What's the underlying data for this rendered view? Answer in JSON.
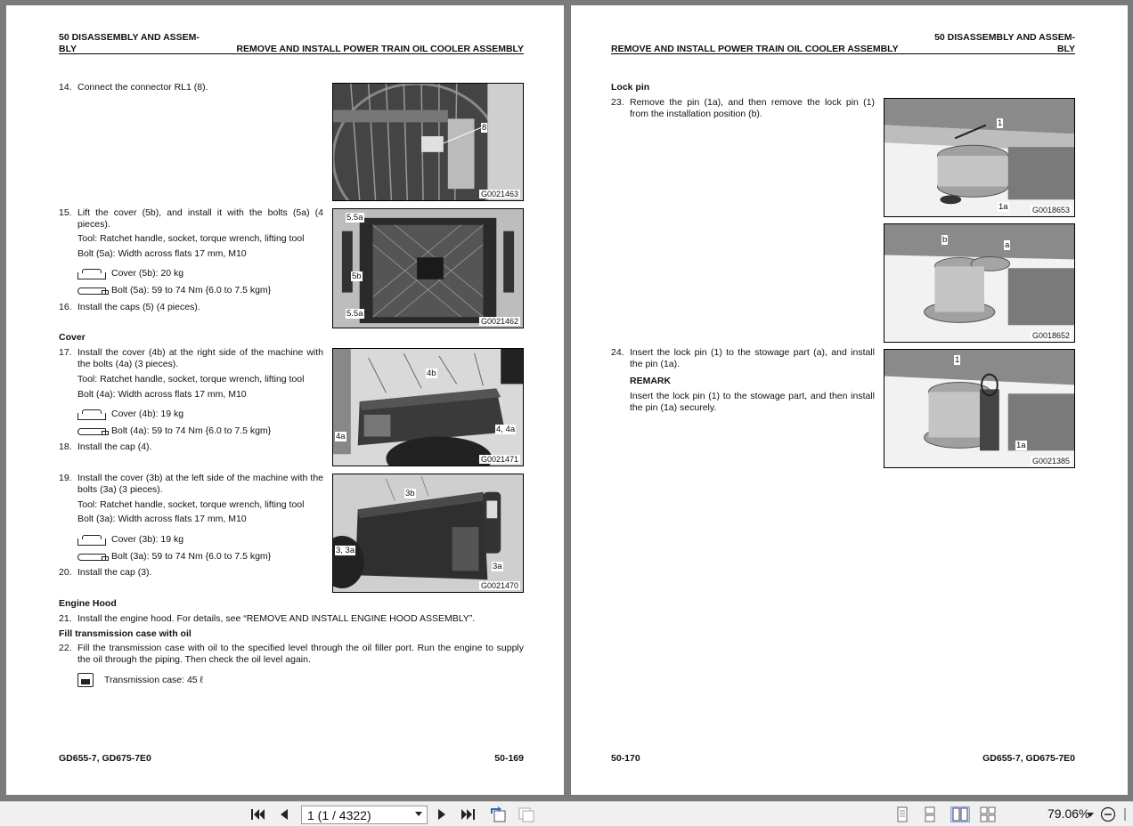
{
  "left_page": {
    "header_left": "50 DISASSEMBLY AND ASSEM-\nBLY",
    "header_right": "REMOVE AND INSTALL POWER TRAIN OIL COOLER ASSEMBLY",
    "steps": {
      "s14": {
        "num": "14.",
        "text": "Connect the connector RL1 (8)."
      },
      "s15": {
        "num": "15.",
        "text": "Lift the cover (5b), and install it with the bolts (5a) (4 pieces).",
        "tool": "Tool: Ratchet handle, socket, torque wrench, lifting tool",
        "bolt": "Bolt (5a): Width across flats 17 mm, M10",
        "weight": "Cover (5b): 20 kg",
        "torque": "Bolt (5a): 59 to 74 Nm {6.0 to 7.5 kgm}"
      },
      "s16": {
        "num": "16.",
        "text": "Install the caps (5) (4 pieces)."
      },
      "cover_heading": "Cover",
      "s17": {
        "num": "17.",
        "text": "Install the cover (4b) at the right side of the machine with the bolts (4a) (3 pieces).",
        "tool": "Tool: Ratchet handle, socket, torque wrench, lifting tool",
        "bolt": "Bolt (4a): Width across flats 17 mm, M10",
        "weight": "Cover (4b): 19 kg",
        "torque": "Bolt (4a): 59 to 74 Nm {6.0 to 7.5 kgm}"
      },
      "s18": {
        "num": "18.",
        "text": "Install the cap (4)."
      },
      "s19": {
        "num": "19.",
        "text": "Install the cover (3b) at the left side of the machine with the bolts (3a) (3 pieces).",
        "tool": "Tool: Ratchet handle, socket, torque wrench, lifting tool",
        "bolt": "Bolt (3a): Width across flats 17 mm, M10",
        "weight": "Cover (3b): 19 kg",
        "torque": "Bolt (3a): 59 to 74 Nm {6.0 to 7.5 kgm}"
      },
      "s20": {
        "num": "20.",
        "text": "Install the cap (3)."
      },
      "hood_heading": "Engine Hood",
      "s21": {
        "num": "21.",
        "text": "Install the engine hood. For details, see “REMOVE AND INSTALL ENGINE HOOD ASSEMBLY”."
      },
      "fill_heading": "Fill transmission case with oil",
      "s22": {
        "num": "22.",
        "text": "Fill the transmission case with oil to the specified level through the oil filler port. Run the engine to supply the oil through the piping. Then check the oil level again.",
        "oil": "Transmission case: 45 ℓ"
      }
    },
    "figures": {
      "f1": {
        "code": "G0021463",
        "callouts": [
          "8"
        ]
      },
      "f2": {
        "code": "G0021462",
        "callouts": [
          "5.5a",
          "5b",
          "5.5a"
        ]
      },
      "f3": {
        "code": "G0021471",
        "callouts": [
          "4b",
          "4a",
          "4, 4a"
        ]
      },
      "f4": {
        "code": "G0021470",
        "callouts": [
          "3b",
          "3, 3a",
          "3a"
        ]
      }
    },
    "footer_left": "GD655-7, GD675-7E0",
    "footer_right": "50-169"
  },
  "right_page": {
    "header_left": "REMOVE AND INSTALL POWER TRAIN OIL COOLER ASSEMBLY",
    "header_right": "50 DISASSEMBLY AND ASSEM-\nBLY",
    "lockpin_heading": "Lock pin",
    "s23": {
      "num": "23.",
      "text": "Remove the pin (1a), and then remove the lock pin (1) from the installation position (b)."
    },
    "s24": {
      "num": "24.",
      "text": "Insert the lock pin (1) to the stowage part (a), and install the pin (1a).",
      "remark_heading": "REMARK",
      "remark": "Insert the lock pin (1) to the stowage part, and then install the pin (1a) securely."
    },
    "figures": {
      "f5": {
        "code": "G0018653",
        "callouts": [
          "1",
          "1a"
        ]
      },
      "f6": {
        "code": "G0018652",
        "callouts": [
          "b",
          "a"
        ]
      },
      "f7": {
        "code": "G0021385",
        "callouts": [
          "1",
          "1a"
        ]
      }
    },
    "footer_left": "50-170",
    "footer_right": "GD655-7, GD675-7E0"
  },
  "toolbar": {
    "page_value": "1 (1 / 4322)",
    "zoom": "79.06%"
  }
}
